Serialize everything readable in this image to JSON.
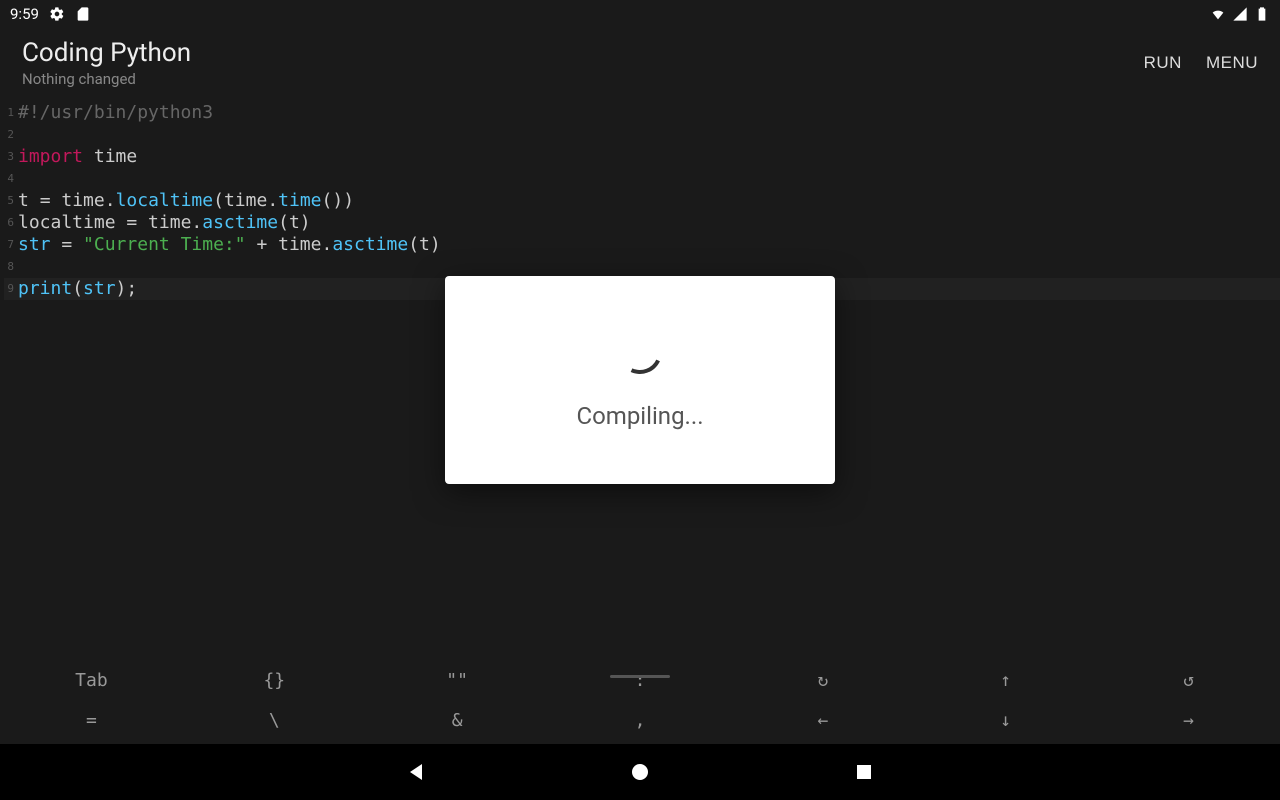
{
  "status": {
    "time": "9:59"
  },
  "header": {
    "title": "Coding Python",
    "subtitle": "Nothing changed",
    "run_label": "RUN",
    "menu_label": "MENU"
  },
  "code": {
    "lines": [
      {
        "n": "1",
        "seg": [
          {
            "c": "tok-comment",
            "t": "#!/usr/bin/python3"
          }
        ]
      },
      {
        "n": "2",
        "seg": []
      },
      {
        "n": "3",
        "seg": [
          {
            "c": "tok-keyword",
            "t": "import"
          },
          {
            "c": "tok-ident",
            "t": " time"
          }
        ]
      },
      {
        "n": "4",
        "seg": []
      },
      {
        "n": "5",
        "seg": [
          {
            "c": "tok-ident",
            "t": "t "
          },
          {
            "c": "tok-op",
            "t": "="
          },
          {
            "c": "tok-ident",
            "t": " time"
          },
          {
            "c": "tok-punct",
            "t": "."
          },
          {
            "c": "tok-func",
            "t": "localtime"
          },
          {
            "c": "tok-punct",
            "t": "("
          },
          {
            "c": "tok-ident",
            "t": "time"
          },
          {
            "c": "tok-punct",
            "t": "."
          },
          {
            "c": "tok-func",
            "t": "time"
          },
          {
            "c": "tok-punct",
            "t": "())"
          }
        ]
      },
      {
        "n": "6",
        "seg": [
          {
            "c": "tok-ident",
            "t": "localtime "
          },
          {
            "c": "tok-op",
            "t": "="
          },
          {
            "c": "tok-ident",
            "t": " time"
          },
          {
            "c": "tok-punct",
            "t": "."
          },
          {
            "c": "tok-func",
            "t": "asctime"
          },
          {
            "c": "tok-punct",
            "t": "("
          },
          {
            "c": "tok-ident",
            "t": "t"
          },
          {
            "c": "tok-punct",
            "t": ")"
          }
        ]
      },
      {
        "n": "7",
        "seg": [
          {
            "c": "tok-builtin",
            "t": "str"
          },
          {
            "c": "tok-ident",
            "t": " "
          },
          {
            "c": "tok-op",
            "t": "="
          },
          {
            "c": "tok-ident",
            "t": " "
          },
          {
            "c": "tok-string",
            "t": "\"Current Time:\""
          },
          {
            "c": "tok-ident",
            "t": " "
          },
          {
            "c": "tok-op",
            "t": "+"
          },
          {
            "c": "tok-ident",
            "t": " time"
          },
          {
            "c": "tok-punct",
            "t": "."
          },
          {
            "c": "tok-func",
            "t": "asctime"
          },
          {
            "c": "tok-punct",
            "t": "("
          },
          {
            "c": "tok-ident",
            "t": "t"
          },
          {
            "c": "tok-punct",
            "t": ")"
          }
        ]
      },
      {
        "n": "8",
        "seg": []
      },
      {
        "n": "9",
        "hl": true,
        "seg": [
          {
            "c": "tok-builtin",
            "t": "print"
          },
          {
            "c": "tok-punct",
            "t": "("
          },
          {
            "c": "tok-builtin",
            "t": "str"
          },
          {
            "c": "tok-punct",
            "t": ");"
          }
        ]
      }
    ]
  },
  "dialog": {
    "text": "Compiling..."
  },
  "keys": {
    "row1": [
      "Tab",
      "{}",
      "\"\"",
      ":",
      "↻",
      "↑",
      "↺"
    ],
    "row2": [
      "=",
      "\\",
      "&",
      ",",
      "←",
      "↓",
      "→"
    ]
  }
}
